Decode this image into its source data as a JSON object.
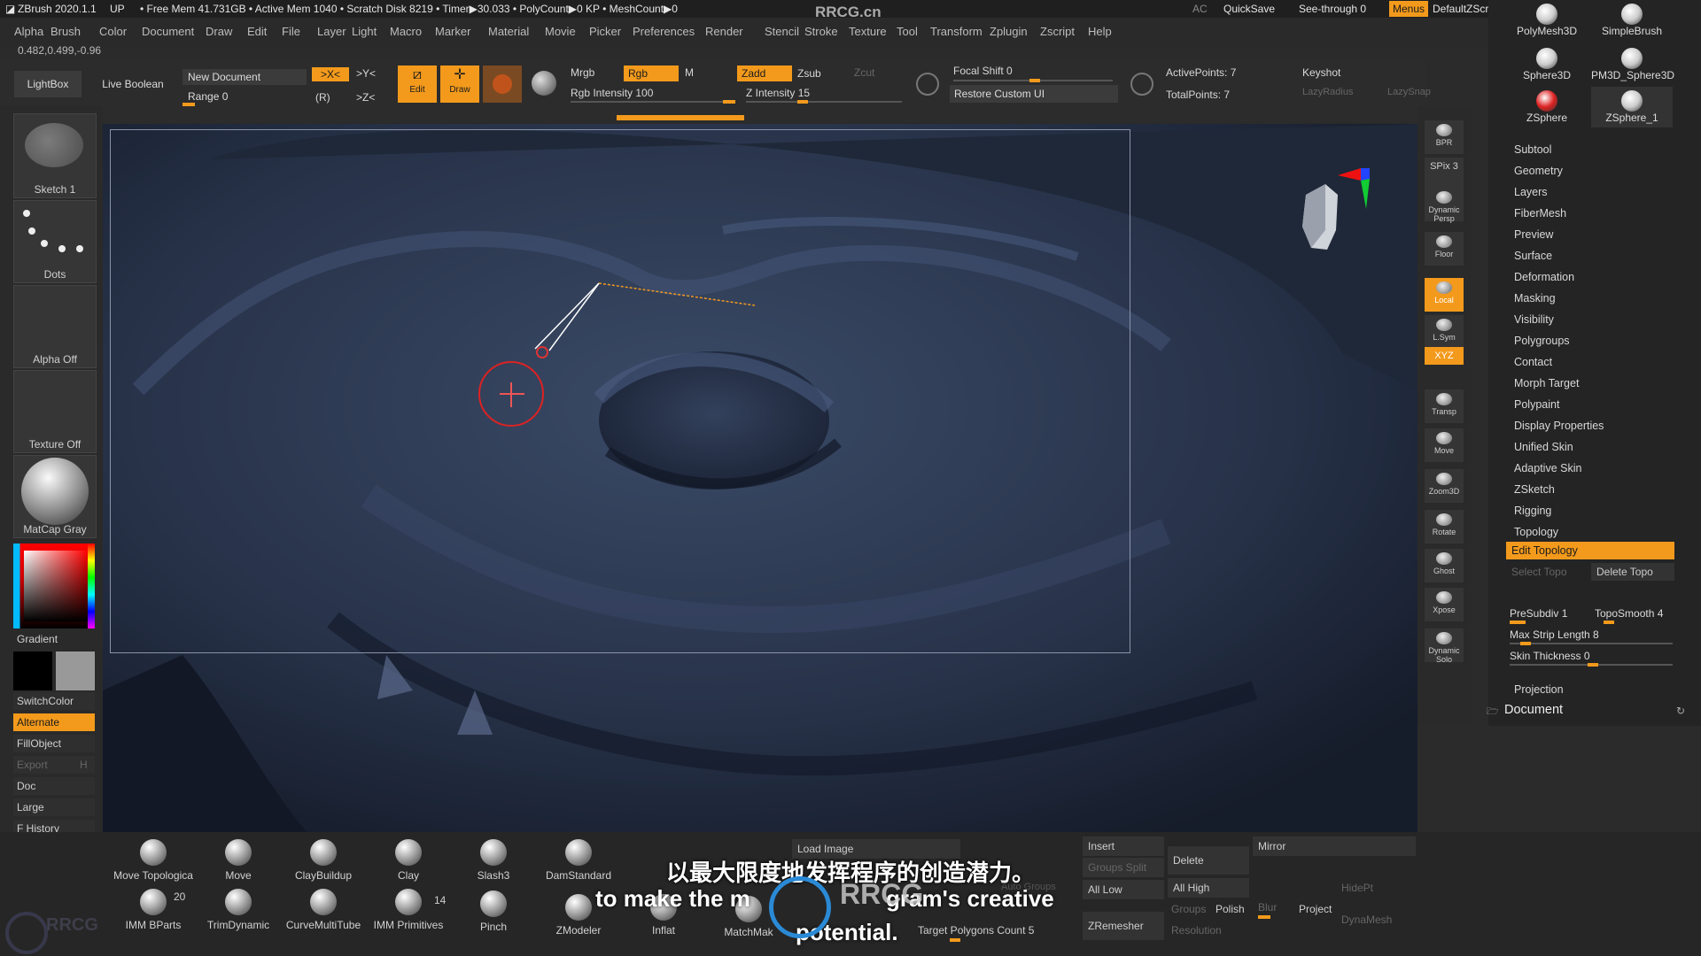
{
  "status": {
    "app": "ZBrush 2020.1.1",
    "up": "UP",
    "mem": "• Free Mem 41.731GB • Active Mem 1040 • Scratch Disk 8219 • Timer▶30.033 • PolyCount▶0 KP • MeshCount▶0",
    "watermark": "RRCG.cn",
    "ac": "AC",
    "quicksave": "QuickSave",
    "seethrough": "See-through  0",
    "menus": "Menus",
    "script": "DefaultZScript"
  },
  "menu": [
    "Alpha",
    "Brush",
    "Color",
    "Document",
    "Draw",
    "Edit",
    "File",
    "Layer",
    "Light",
    "Macro",
    "Marker",
    "Material",
    "Movie",
    "Picker",
    "Preferences",
    "Render",
    "Stencil",
    "Stroke",
    "Texture",
    "Tool",
    "Transform",
    "Zplugin",
    "Zscript",
    "Help"
  ],
  "coords": "0.482,0.499,-0.96",
  "toolrow": {
    "lightbox": "LightBox",
    "liveboolean": "Live Boolean",
    "newdoc": "New Document",
    "range": "Range 0",
    "sx": ">X<",
    "sy": ">Y<",
    "sz": ">Z<",
    "r": "(R)",
    "edit": "Edit",
    "draw": "Draw",
    "mrgb": "Mrgb",
    "rgb": "Rgb",
    "m": "M",
    "rgbint": "Rgb Intensity 100",
    "zadd": "Zadd",
    "zsub": "Zsub",
    "zcut": "Zcut",
    "zint": "Z Intensity 15",
    "focal": "Focal Shift 0",
    "restore": "Restore Custom UI",
    "active": "ActivePoints: 7",
    "total": "TotalPoints: 7",
    "keyshot": "Keyshot",
    "lazyr": "LazyRadius",
    "lazys": "LazySnap"
  },
  "left": {
    "sketch": "Sketch 1",
    "dots": "Dots",
    "alpha": "Alpha Off",
    "texture": "Texture Off",
    "matcap": "MatCap Gray",
    "gradient": "Gradient",
    "switch": "SwitchColor",
    "alternate": "Alternate",
    "fill": "FillObject",
    "export": "Export",
    "h": "H",
    "doc": "Doc",
    "large": "Large",
    "fhist": "F History"
  },
  "right_tools": [
    "BPR",
    "SPix 3",
    "Dynamic Persp",
    "Floor",
    "Local",
    "L.Sym",
    "XYZ",
    "Transp",
    "Move",
    "Zoom3D",
    "Rotate",
    "Ghost",
    "Xpose",
    "Dynamic Solo"
  ],
  "tool_thumbs": [
    "PolyMesh3D",
    "SimpleBrush",
    "Sphere3D",
    "PM3D_Sphere3D",
    "ZSphere",
    "ZSphere_1"
  ],
  "subpalette": [
    "Subtool",
    "Geometry",
    "Layers",
    "FiberMesh",
    "Preview",
    "Surface",
    "Deformation",
    "Masking",
    "Visibility",
    "Polygroups",
    "Contact",
    "Morph Target",
    "Polypaint",
    "Display Properties",
    "Unified Skin",
    "Adaptive Skin",
    "ZSketch",
    "Rigging"
  ],
  "topology": {
    "title": "Topology",
    "edit": "Edit Topology",
    "select": "Select Topo",
    "delete": "Delete Topo",
    "presubdiv": "PreSubdiv 1",
    "toposmooth": "TopoSmooth 4",
    "maxstrip": "Max Strip Length 8",
    "skin": "Skin Thickness 0",
    "projection": "Projection",
    "document": "Document"
  },
  "brushes": [
    {
      "name": "Move Topologica"
    },
    {
      "name": "Move"
    },
    {
      "name": "ClayBuildup"
    },
    {
      "name": "Clay"
    },
    {
      "name": "Slash3"
    },
    {
      "name": "DamStandard"
    },
    {
      "name": "IMM BParts"
    },
    {
      "name": "TrimDynamic"
    },
    {
      "name": "CurveMultiTube"
    },
    {
      "name": "IMM Primitives"
    },
    {
      "name": "Pinch"
    },
    {
      "name": "ZModeler"
    },
    {
      "name": "Inflat"
    },
    {
      "name": "MatchMak"
    }
  ],
  "brushcounts": {
    "bparts": "20",
    "prims": "14"
  },
  "bottom": {
    "loadimage": "Load Image",
    "insert": "Insert",
    "delete": "Delete",
    "mirror": "Mirror",
    "groupsplit": "Groups Split",
    "autogroups": "Auto Groups",
    "alllow": "All Low",
    "allhigh": "All High",
    "hidept": "HidePt",
    "groups": "Groups",
    "polish": "Polish",
    "blur": "Blur",
    "project": "Project",
    "dynamesh": "DynaMesh",
    "target": "Target Polygons Count 5",
    "zremesher": "ZRemesher",
    "resolution": "Resolution"
  },
  "subtitle": {
    "zh": "以最大限度地发挥程序的创造潜力。",
    "en1": "to make the m",
    "en2": "gram's creative",
    "en3": "potential."
  },
  "logo": "RRCG"
}
